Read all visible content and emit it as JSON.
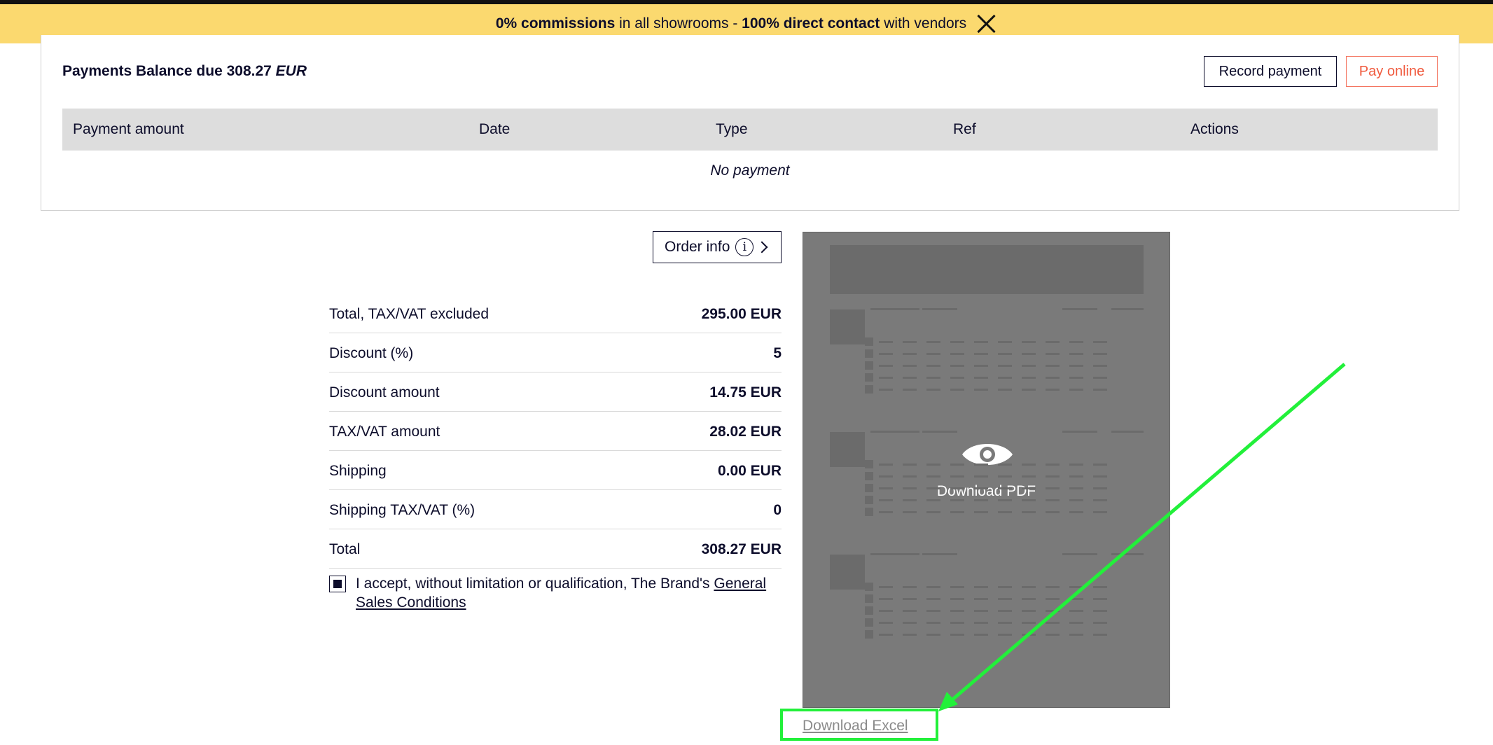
{
  "banner": {
    "part1_bold": "0% commissions",
    "part2": " in all showrooms - ",
    "part3_bold": "100% direct contact",
    "part4": " with vendors"
  },
  "payments": {
    "title_prefix": "Payments Balance due 308.27 ",
    "title_currency": "EUR",
    "record_button": "Record payment",
    "pay_online_button": "Pay online",
    "columns": [
      "Payment amount",
      "Date",
      "Type",
      "Ref",
      "Actions"
    ],
    "empty_text": "No payment"
  },
  "order_info": {
    "label": "Order info",
    "icon_glyph": "i"
  },
  "totals": [
    {
      "label": "Total, TAX/VAT excluded",
      "value": "295.00 EUR"
    },
    {
      "label": "Discount (%)",
      "value": "5"
    },
    {
      "label": "Discount amount",
      "value": "14.75 EUR"
    },
    {
      "label": "TAX/VAT amount",
      "value": "28.02 EUR"
    },
    {
      "label": "Shipping",
      "value": "0.00 EUR"
    },
    {
      "label": "Shipping TAX/VAT (%)",
      "value": "0"
    },
    {
      "label": "Total",
      "value": "308.27 EUR"
    }
  ],
  "terms": {
    "checked": true,
    "text": "I accept, without limitation or qualification, The Brand's ",
    "link_line1": "General",
    "link_line2": "Sales Conditions"
  },
  "pdf": {
    "label": "Download PDF",
    "icon": "eye-icon"
  },
  "excel": {
    "label": "Download Excel"
  },
  "colors": {
    "banner": "#fbd96f",
    "accent_orange": "#f05a3e",
    "highlight_green": "#22f03a",
    "text_dark": "#0d0d2b"
  }
}
